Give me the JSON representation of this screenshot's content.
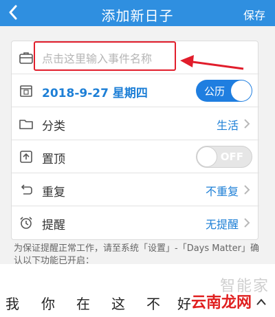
{
  "nav": {
    "title": "添加新日子",
    "save": "保存"
  },
  "event": {
    "placeholder": "点击这里输入事件名称"
  },
  "date": {
    "text": "2018-9-27 星期四",
    "calendar_toggle": "公历"
  },
  "category": {
    "label": "分类",
    "value": "生活"
  },
  "pin": {
    "label": "置顶",
    "toggle": "OFF"
  },
  "repeat": {
    "label": "重复",
    "value": "不重复"
  },
  "remind": {
    "label": "提醒",
    "value": "无提醒"
  },
  "note": "为保证提醒正常工作，请至系统「设置」-「Days Matter」确认以下功能已开启：",
  "keyboard": {
    "chars": [
      "我",
      "你",
      "在",
      "这",
      "不",
      "好"
    ]
  },
  "watermark": {
    "top": "智能家",
    "bottom": "云南龙网"
  },
  "colors": {
    "nav": "#2f8fe0",
    "accent": "#1d7fd6",
    "annotation": "#e11d2b"
  }
}
